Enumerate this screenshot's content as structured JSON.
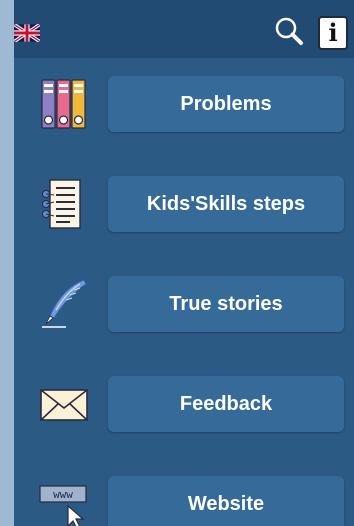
{
  "header": {
    "flag_icon": "uk-flag-icon",
    "search_icon": "search-icon",
    "info_glyph": "i"
  },
  "menu": {
    "items": [
      {
        "label": "Problems",
        "icon": "binders-icon"
      },
      {
        "label": "Kids'Skills steps",
        "icon": "checklist-document-icon"
      },
      {
        "label": "True stories",
        "icon": "quill-pen-icon"
      },
      {
        "label": "Feedback",
        "icon": "envelope-icon"
      },
      {
        "label": "Website",
        "icon": "www-cursor-icon"
      }
    ]
  },
  "colors": {
    "page_background": "#9db9d4",
    "app_background": "#2b5a85",
    "topbar": "#224b73",
    "button": "#356a99",
    "text": "#ffffff"
  }
}
